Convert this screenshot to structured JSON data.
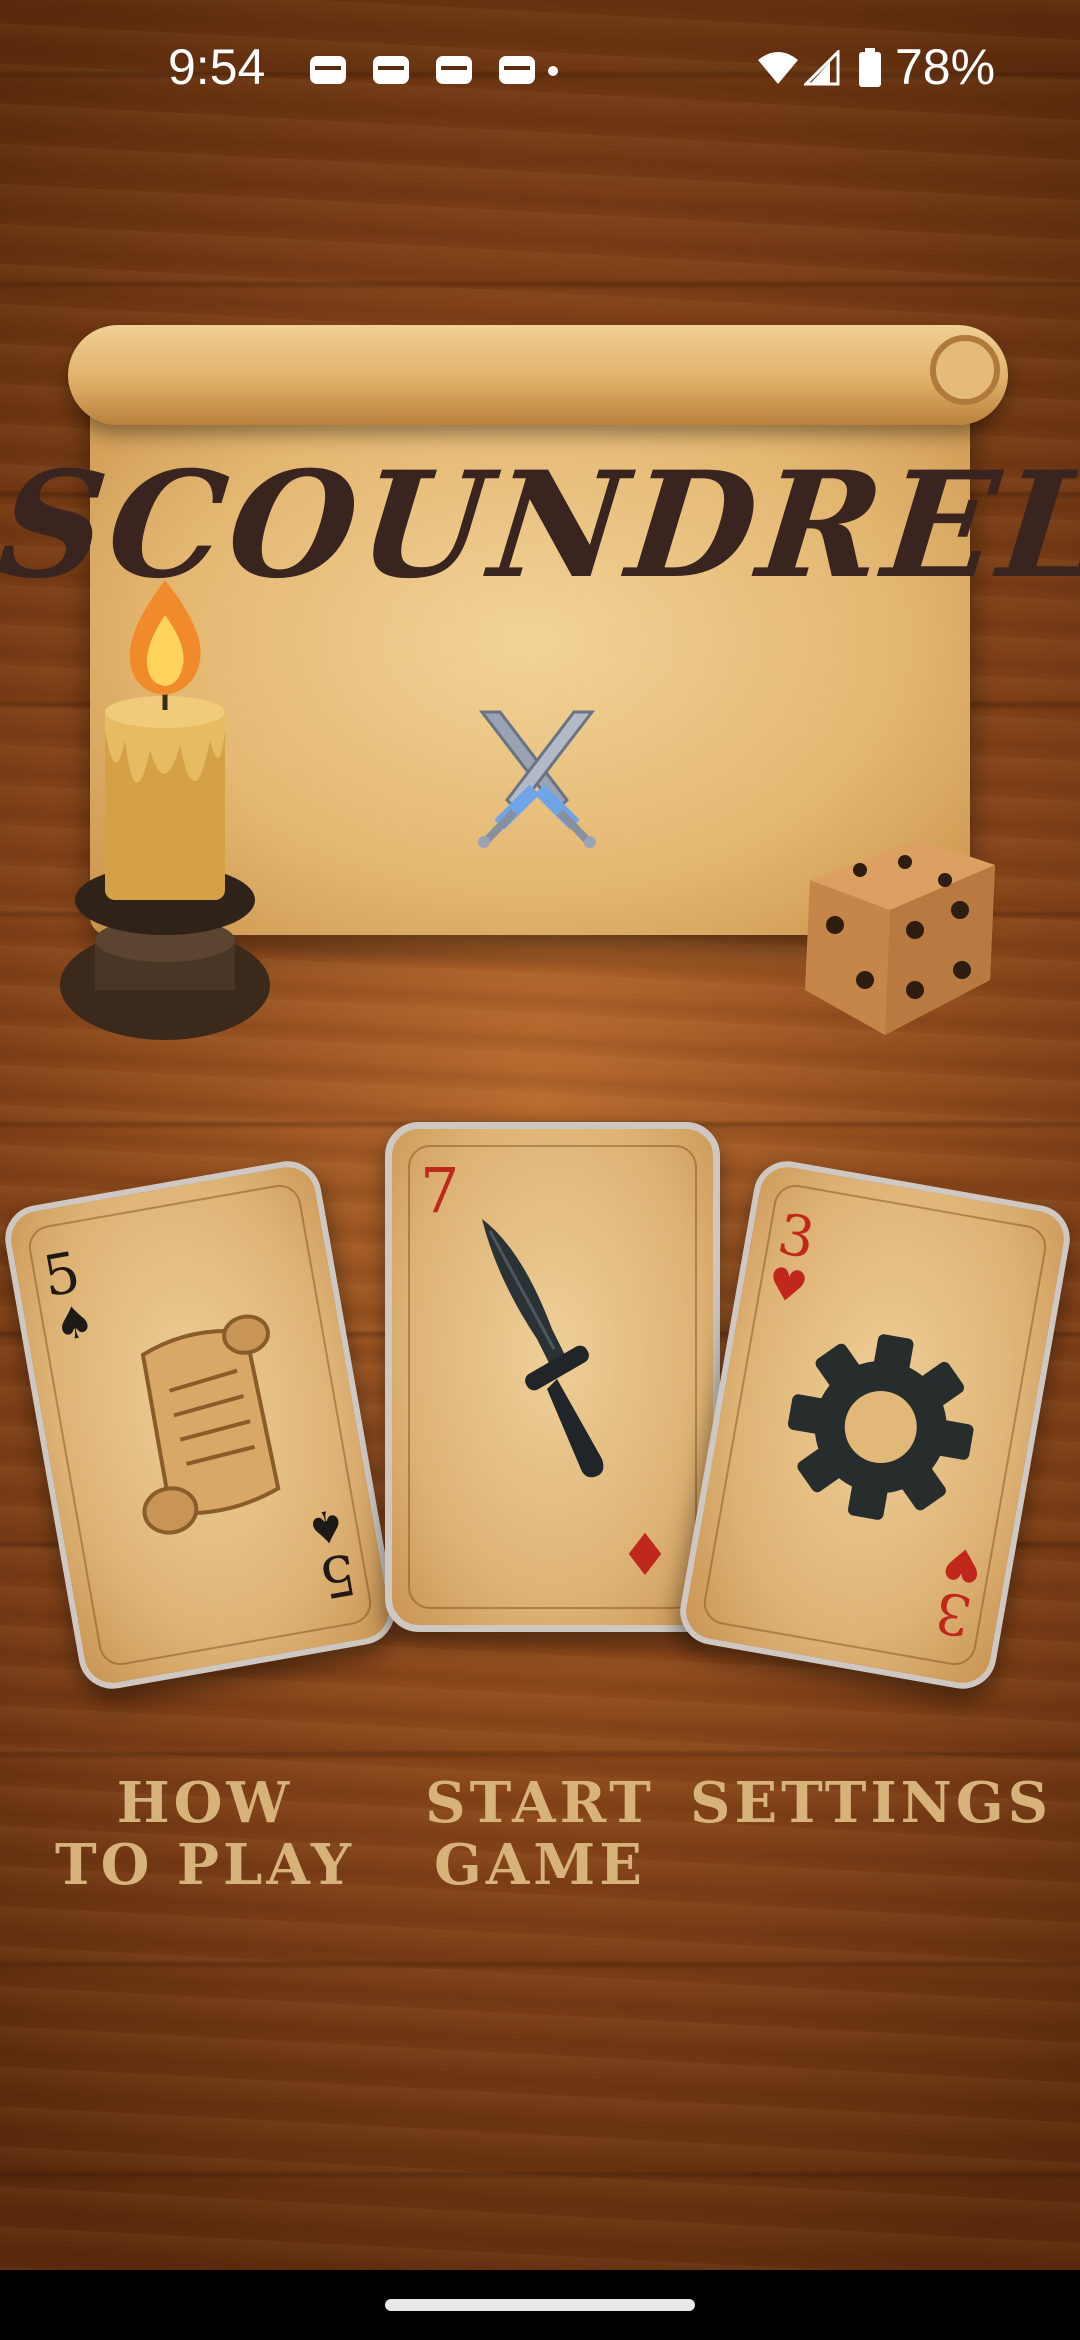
{
  "status_bar": {
    "time": "9:54",
    "battery_percent": "78%",
    "notification_icons": [
      "app-notification-icon",
      "app-notification-icon",
      "app-notification-icon",
      "app-notification-icon"
    ]
  },
  "game": {
    "title": "SCOUNDREL"
  },
  "menu": {
    "how_to_play": {
      "label_line1": "HOW",
      "label_line2": "TO PLAY",
      "card_rank": "5",
      "card_suit": "♠",
      "card_suit_color": "#1e1a17",
      "icon": "scroll-icon"
    },
    "start_game": {
      "label_line1": "START",
      "label_line2": "GAME",
      "card_rank": "7",
      "card_suit": "♦",
      "card_suit_color": "#c0281c",
      "icon": "dagger-icon"
    },
    "settings": {
      "label": "SETTINGS",
      "card_rank": "3",
      "card_suit": "♥",
      "card_suit_color": "#c0281c",
      "icon": "gear-icon"
    }
  },
  "colors": {
    "menu_text": "#d7b27a",
    "title_text": "#3a2420",
    "wood": "#8f4a1c"
  }
}
